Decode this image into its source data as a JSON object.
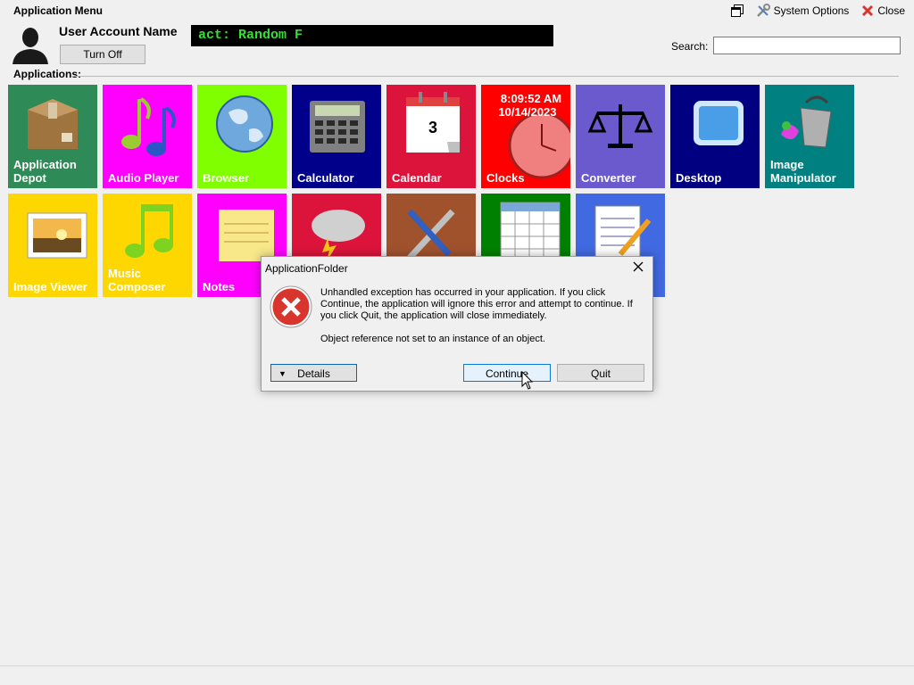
{
  "window": {
    "title": "Application Menu"
  },
  "toolbar": {
    "system_options": "System Options",
    "close": "Close"
  },
  "user": {
    "name": "User Account Name",
    "turn_off": "Turn Off"
  },
  "ticker": {
    "text": "act:  Random F"
  },
  "search": {
    "label": "Search:",
    "value": ""
  },
  "apps_label": "Applications:",
  "tiles": [
    {
      "label": "Application Depot",
      "color": "#2e8b57",
      "icon": "package-box-icon"
    },
    {
      "label": "Audio Player",
      "color": "#ff00ff",
      "icon": "music-notes-icon"
    },
    {
      "label": "Browser",
      "color": "#7fff00",
      "icon": "globe-icon"
    },
    {
      "label": "Calculator",
      "color": "#00008b",
      "icon": "calculator-icon"
    },
    {
      "label": "Calendar",
      "color": "#dc143c",
      "icon": "calendar-icon",
      "day": "3"
    },
    {
      "label": "Clocks",
      "color": "#ff0000",
      "icon": "clock-icon",
      "time": "8:09:52 AM",
      "date": "10/14/2023"
    },
    {
      "label": "Converter",
      "color": "#6a5acd",
      "icon": "scales-icon"
    },
    {
      "label": "Desktop",
      "color": "#000080",
      "icon": "monitor-icon"
    },
    {
      "label": "Image Manipulator",
      "color": "#008080",
      "icon": "paint-bucket-icon"
    },
    {
      "label": "Image Viewer",
      "color": "#ffd700",
      "icon": "picture-icon"
    },
    {
      "label": "Music Composer",
      "color": "#ffd700",
      "icon": "music-note-icon"
    },
    {
      "label": "Notes",
      "color": "#ff00ff",
      "icon": "sticky-note-icon"
    },
    {
      "label": "",
      "color": "#dc143c",
      "icon": "storm-cloud-icon"
    },
    {
      "label": "",
      "color": "#a0522d",
      "icon": "tools-icon"
    },
    {
      "label": "",
      "color": "#008000",
      "icon": "spreadsheet-icon"
    },
    {
      "label": "",
      "color": "#4169e1",
      "icon": "notepad-pencil-icon"
    }
  ],
  "dialog": {
    "title": "ApplicationFolder",
    "message": "Unhandled exception has occurred in your application. If you click Continue, the application will ignore this error and attempt to continue. If you click Quit, the application will close immediately.",
    "detail": "Object reference not set to an instance of an object.",
    "details_button": "Details",
    "continue_button": "Continue",
    "quit_button": "Quit"
  }
}
